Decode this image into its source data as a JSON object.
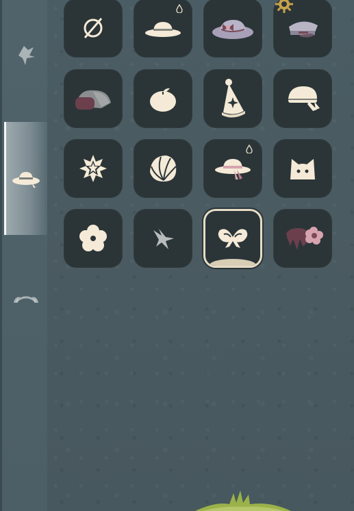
{
  "sidebar": {
    "tabs": [
      {
        "name": "hair",
        "icon": "hair-icon"
      },
      {
        "name": "hats",
        "icon": "sun-hat-icon",
        "active": true
      },
      {
        "name": "horns",
        "icon": "horns-icon"
      }
    ]
  },
  "grid": {
    "items": [
      {
        "icon": "none-icon"
      },
      {
        "icon": "sun-hat-icon",
        "badge": "drop-icon"
      },
      {
        "icon": "bow-bonnet-icon"
      },
      {
        "icon": "captain-cap-icon",
        "badge": "gear-icon"
      },
      {
        "icon": "rock-hat-icon"
      },
      {
        "icon": "peach-icon"
      },
      {
        "icon": "party-hat-icon"
      },
      {
        "icon": "beret-icon"
      },
      {
        "icon": "star-badge-icon"
      },
      {
        "icon": "seashell-icon"
      },
      {
        "icon": "ribbon-sun-hat-icon",
        "badge": "drop-icon"
      },
      {
        "icon": "cat-ears-icon"
      },
      {
        "icon": "flower-icon"
      },
      {
        "icon": "bird-clip-icon"
      },
      {
        "icon": "bow-icon",
        "selected": true
      },
      {
        "icon": "flower-claw-clip-icon"
      }
    ]
  },
  "colors": {
    "cell_bg": "#2b3538",
    "icon_cream": "#f4ead7",
    "icon_mauve": "#7a4a58",
    "icon_pink": "#d7a3ae",
    "selected_border": "#e6dcc6",
    "gear_gold": "#c9a34a"
  }
}
